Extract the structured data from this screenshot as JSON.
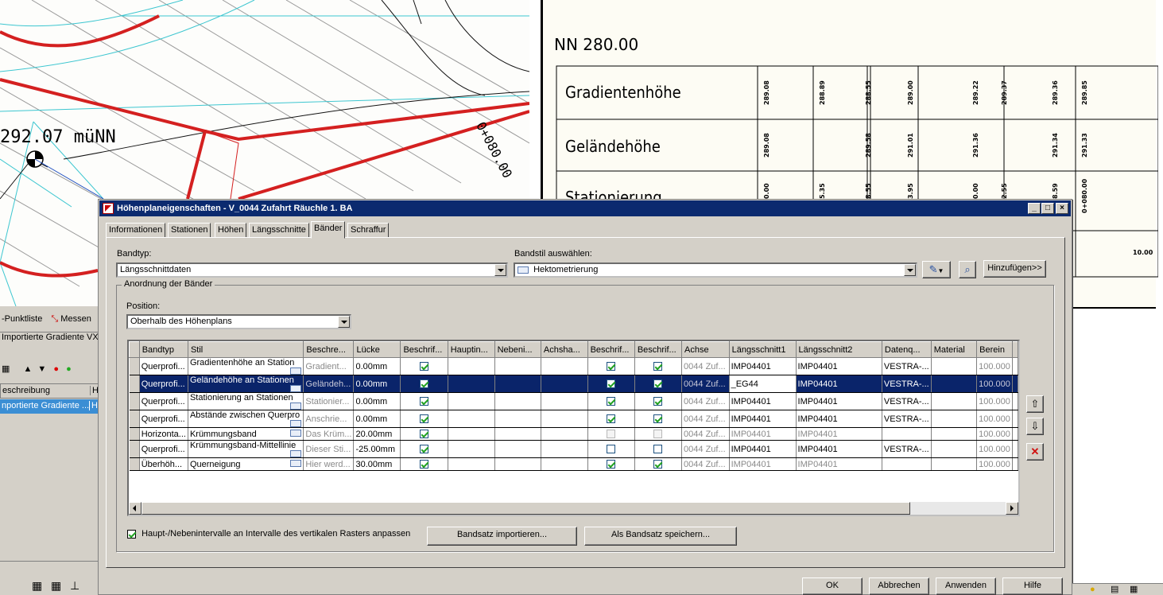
{
  "cad": {
    "elevation_label": "292.07 müNN",
    "station_label": "0+080.00",
    "datum_label": "NN 280.00",
    "rows": [
      "Gradientenhöhe",
      "Geländehöhe",
      "Stationierung"
    ],
    "gradient_values": [
      "289.08",
      "288.89",
      "288.55",
      "289.00",
      "289.22",
      "289.37",
      "289.36",
      "289.85"
    ],
    "terrain_values": [
      "289.08",
      "289.58",
      "291.01",
      "291.36",
      "291.34",
      "291.33"
    ],
    "station_values": [
      "0.00",
      "5.35",
      "8.55",
      "3.95",
      "0.00",
      "2.55",
      "8.59",
      "0+080.00"
    ],
    "bottom_row_value": "10.00"
  },
  "left_panel": {
    "punktliste": "-Punktliste",
    "messen": "Messen",
    "importierte": "Importierte Gradiente VX",
    "col_beschreibung": "eschreibung",
    "col_h": "H",
    "row_label": "nportierte Gradiente ...",
    "row_h": "H"
  },
  "dialog": {
    "title": "Höhenplaneigenschaften - V_0044 Zufahrt Räuchle 1. BA",
    "tabs": [
      "Informationen",
      "Stationen",
      "Höhen",
      "Längsschnitte",
      "Bänder",
      "Schraffur"
    ],
    "bandtyp_label": "Bandtyp:",
    "bandtyp_value": "Längsschnittdaten",
    "bandstil_label": "Bandstil auswählen:",
    "bandstil_value": "Hektometrierung",
    "hinzufuegen": "Hinzufügen>>",
    "group_title": "Anordnung der Bänder",
    "position_label": "Position:",
    "position_value": "Oberhalb des Höhenplans",
    "columns": [
      "Bandtyp",
      "Stil",
      "Beschre...",
      "Lücke",
      "Beschrif...",
      "Hauptin...",
      "Nebeni...",
      "Achsha...",
      "Beschrif...",
      "Beschrif...",
      "Achse",
      "Längsschnitt1",
      "Längsschnitt2",
      "Datenq...",
      "Material",
      "Berein"
    ],
    "rows": [
      {
        "bandtyp": "Querprofi...",
        "stil": "Gradientenhöhe an Station",
        "beschr": "Gradient...",
        "luecke": "0.00mm",
        "cb1": true,
        "cb2": true,
        "cb3": true,
        "achse": "0044 Zuf...",
        "ls1": "IMP04401",
        "ls2": "IMP04401",
        "daten": "VESTRA-...",
        "material": "",
        "berein": "100.000"
      },
      {
        "bandtyp": "Querprofi...",
        "stil": "Geländehöhe an Stationen",
        "beschr": "Geländeh...",
        "luecke": "0.00mm",
        "cb1": true,
        "cb2": true,
        "cb3": true,
        "achse": "0044 Zuf...",
        "ls1": "_EG44",
        "ls2": "IMP04401",
        "daten": "VESTRA-...",
        "material": "",
        "berein": "100.000"
      },
      {
        "bandtyp": "Querprofi...",
        "stil": "Stationierung an Stationen",
        "beschr": "Stationier...",
        "luecke": "0.00mm",
        "cb1": true,
        "cb2": true,
        "cb3": true,
        "achse": "0044 Zuf...",
        "ls1": "IMP04401",
        "ls2": "IMP04401",
        "daten": "VESTRA-...",
        "material": "",
        "berein": "100.000"
      },
      {
        "bandtyp": "Querprofi...",
        "stil": "Abstände zwischen Querpro",
        "beschr": "Anschrie...",
        "luecke": "0.00mm",
        "cb1": true,
        "cb2": true,
        "cb3": true,
        "achse": "0044 Zuf...",
        "ls1": "IMP04401",
        "ls2": "IMP04401",
        "daten": "VESTRA-...",
        "material": "",
        "berein": "100.000"
      },
      {
        "bandtyp": "Horizonta...",
        "stil": "Krümmungsband",
        "beschr": "Das Krüm...",
        "luecke": "20.00mm",
        "cb1": true,
        "cb2": false,
        "cb3": false,
        "achse": "0044 Zuf...",
        "ls1": "IMP04401",
        "ls2": "IMP04401",
        "daten": "",
        "material": "",
        "berein": "100.000"
      },
      {
        "bandtyp": "Querprofi...",
        "stil": "Krümmungsband-Mittellinie",
        "beschr": "Dieser Sti...",
        "luecke": "-25.00mm",
        "cb1": true,
        "cb2": false,
        "cb3": false,
        "achse": "0044 Zuf...",
        "ls1": "IMP04401",
        "ls2": "IMP04401",
        "daten": "VESTRA-...",
        "material": "",
        "berein": "100.000"
      },
      {
        "bandtyp": "Überhöh...",
        "stil": "Querneigung",
        "beschr": "Hier werd...",
        "luecke": "30.00mm",
        "cb1": true,
        "cb2": true,
        "cb3": true,
        "achse": "0044 Zuf...",
        "ls1": "IMP04401",
        "ls2": "IMP04401",
        "daten": "",
        "material": "",
        "berein": "100.000"
      }
    ],
    "checkbox_label": "Haupt-/Nebenintervalle an Intervalle des vertikalen Rasters anpassen",
    "import_button": "Bandsatz importieren...",
    "save_button": "Als Bandsatz speichern...",
    "ok": "OK",
    "cancel": "Abbrechen",
    "apply": "Anwenden",
    "help": "Hilfe"
  }
}
